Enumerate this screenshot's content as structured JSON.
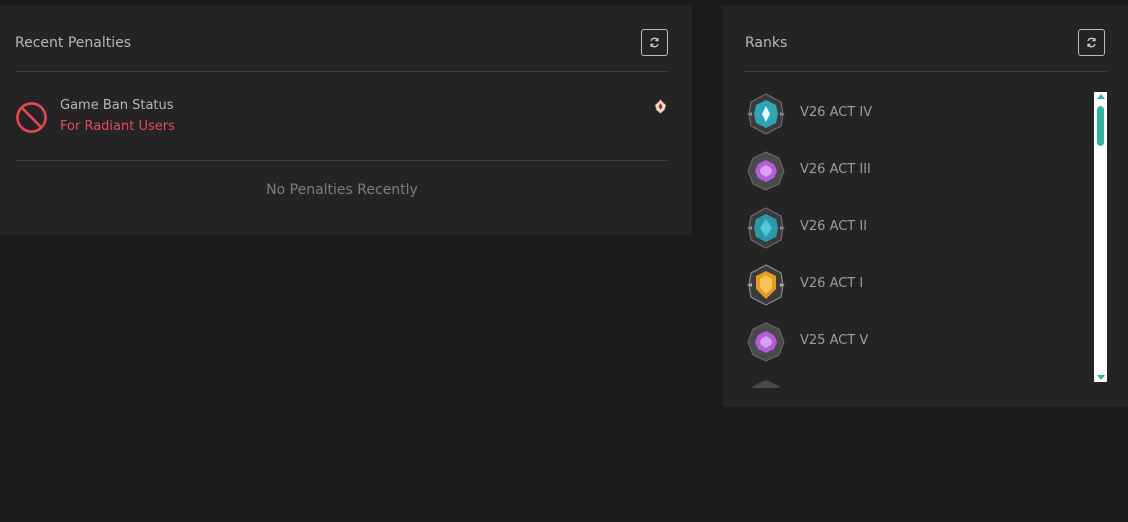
{
  "penalties": {
    "title": "Recent Penalties",
    "refresh_icon": "refresh-icon",
    "ban_status": {
      "icon": "ban-icon",
      "title": "Game Ban Status",
      "subtitle": "For Radiant Users",
      "subtitle_color": "#e84855",
      "rank_icon": "radiant-icon"
    },
    "empty_message": "No Penalties Recently"
  },
  "ranks": {
    "title": "Ranks",
    "refresh_icon": "refresh-icon",
    "items": [
      {
        "label": "V26 ACT IV",
        "badge": "diamond-rank-icon",
        "color": "#2fa4b5"
      },
      {
        "label": "V26 ACT III",
        "badge": "ascendant-rank-icon",
        "color": "#b35ddb"
      },
      {
        "label": "V26 ACT II",
        "badge": "diamond-rank-icon",
        "color": "#2fa4b5"
      },
      {
        "label": "V26 ACT I",
        "badge": "gold-rank-icon",
        "color": "#e69a1c"
      },
      {
        "label": "V25 ACT V",
        "badge": "ascendant-rank-icon",
        "color": "#b35ddb"
      }
    ]
  },
  "colors": {
    "background": "#1c1b1c",
    "panel": "#252425",
    "accent": "#2eb4a0",
    "danger": "#e84855"
  }
}
